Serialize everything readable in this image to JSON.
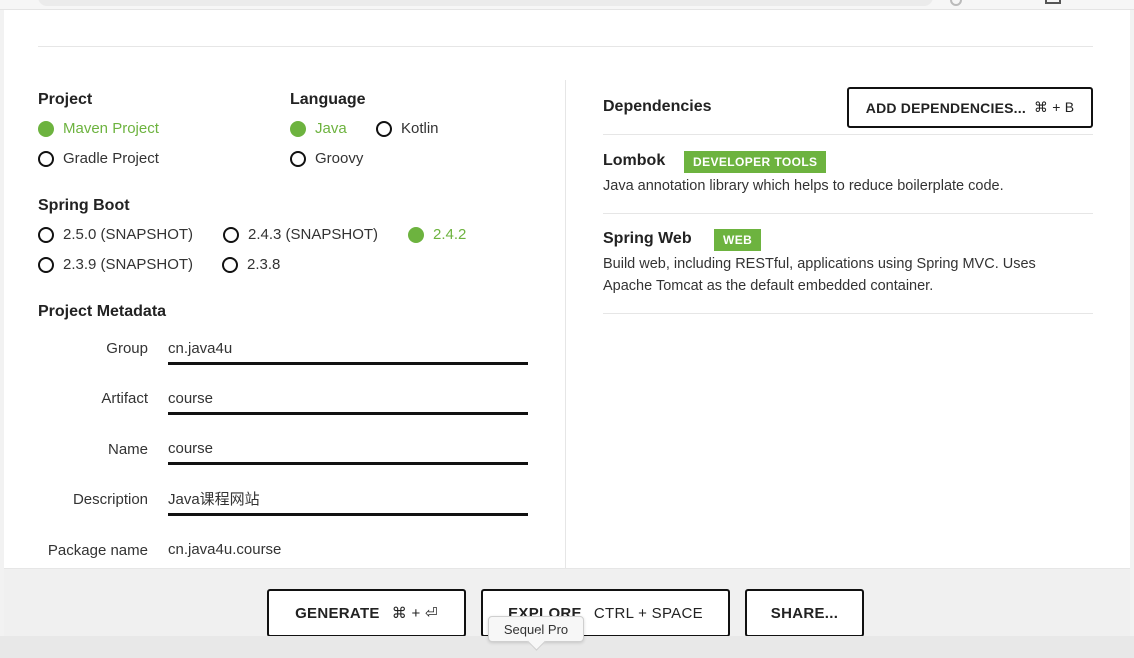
{
  "project": {
    "title": "Project",
    "options": [
      {
        "label": "Maven Project",
        "selected": true
      },
      {
        "label": "Gradle Project",
        "selected": false
      }
    ]
  },
  "language": {
    "title": "Language",
    "options": [
      {
        "label": "Java",
        "selected": true
      },
      {
        "label": "Kotlin",
        "selected": false
      },
      {
        "label": "Groovy",
        "selected": false
      }
    ]
  },
  "spring_boot": {
    "title": "Spring Boot",
    "options": [
      {
        "label": "2.5.0 (SNAPSHOT)",
        "selected": false
      },
      {
        "label": "2.4.3 (SNAPSHOT)",
        "selected": false
      },
      {
        "label": "2.4.2",
        "selected": true
      },
      {
        "label": "2.3.9 (SNAPSHOT)",
        "selected": false
      },
      {
        "label": "2.3.8",
        "selected": false
      }
    ]
  },
  "metadata": {
    "title": "Project Metadata",
    "fields": [
      {
        "label": "Group",
        "value": "cn.java4u"
      },
      {
        "label": "Artifact",
        "value": "course"
      },
      {
        "label": "Name",
        "value": "course"
      },
      {
        "label": "Description",
        "value": "Java课程网站"
      },
      {
        "label": "Package name",
        "value": "cn.java4u.course"
      }
    ]
  },
  "dependencies": {
    "title": "Dependencies",
    "add_button": {
      "label": "ADD DEPENDENCIES...",
      "shortcut": "⌘ + B"
    },
    "items": [
      {
        "name": "Lombok",
        "badge": "DEVELOPER TOOLS",
        "description": "Java annotation library which helps to reduce boilerplate code."
      },
      {
        "name": "Spring Web",
        "badge": "WEB",
        "description_line1": "Build web, including RESTful, applications using Spring MVC. Uses",
        "description_line2": "Apache Tomcat as the default embedded container."
      }
    ]
  },
  "footer": {
    "generate": {
      "label": "GENERATE",
      "shortcut": "⌘ + ⏎"
    },
    "explore": {
      "label": "EXPLORE",
      "shortcut": "CTRL + SPACE"
    },
    "share": {
      "label": "SHARE..."
    }
  },
  "tooltip": "Sequel Pro",
  "colors": {
    "accent": "#6db33f",
    "border": "#111111"
  }
}
